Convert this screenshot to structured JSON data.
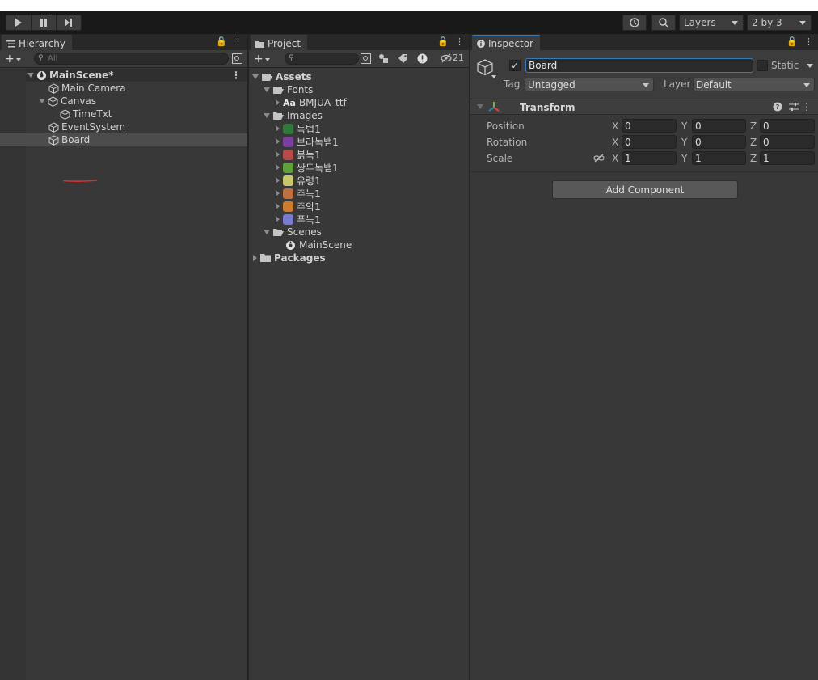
{
  "toolbar": {
    "layers_label": "Layers",
    "layout_label": "2 by 3"
  },
  "hierarchy": {
    "tab_label": "Hierarchy",
    "search_placeholder": "All",
    "scene_name": "MainScene*",
    "items": [
      {
        "label": "Main Camera"
      },
      {
        "label": "Canvas"
      },
      {
        "label": "TimeTxt"
      },
      {
        "label": "EventSystem"
      },
      {
        "label": "Board"
      }
    ]
  },
  "project": {
    "tab_label": "Project",
    "hidden_count": "21",
    "tree": {
      "assets": "Assets",
      "fonts": "Fonts",
      "font_file_prefix": "Aa",
      "font_file": "BMJUA_ttf",
      "images": "Images",
      "image_items": [
        "녹법1",
        "보라녹뱀1",
        "붉늑1",
        "쌍두녹뱀1",
        "유령1",
        "주늑1",
        "주악1",
        "푸늑1"
      ],
      "image_colors": [
        "#2f7a3a",
        "#7a3fa0",
        "#b84a4a",
        "#5fa03a",
        "#c8c86a",
        "#c07040",
        "#d07a30",
        "#7a7ad0"
      ],
      "scenes": "Scenes",
      "main_scene": "MainScene",
      "packages": "Packages"
    }
  },
  "inspector": {
    "tab_label": "Inspector",
    "object_name": "Board",
    "active": true,
    "static_label": "Static",
    "tag_label": "Tag",
    "tag_value": "Untagged",
    "layer_label": "Layer",
    "layer_value": "Default",
    "transform": {
      "title": "Transform",
      "position_label": "Position",
      "rotation_label": "Rotation",
      "scale_label": "Scale",
      "position": {
        "x": "0",
        "y": "0",
        "z": "0"
      },
      "rotation": {
        "x": "0",
        "y": "0",
        "z": "0"
      },
      "scale": {
        "x": "1",
        "y": "1",
        "z": "1"
      },
      "axis_x": "X",
      "axis_y": "Y",
      "axis_z": "Z"
    },
    "add_component_label": "Add Component"
  },
  "colors": {
    "accent": "#3a79bb",
    "annotation_underline": "#d23232"
  }
}
